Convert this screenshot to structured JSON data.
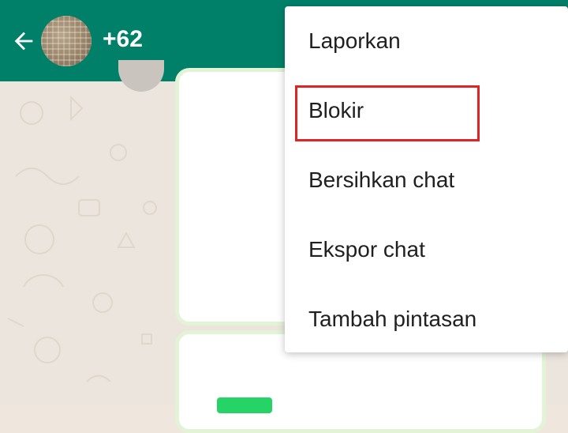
{
  "app_bar": {
    "back_icon": "arrow-left-icon",
    "contact_name": "+62",
    "color": "#008069"
  },
  "menu": {
    "items": [
      {
        "label": "Laporkan"
      },
      {
        "label": "Blokir",
        "highlighted": true
      },
      {
        "label": "Bersihkan chat"
      },
      {
        "label": "Ekspor chat"
      },
      {
        "label": "Tambah pintasan"
      }
    ]
  },
  "colors": {
    "highlight": "#e02424",
    "chat_background": "#ece5dd",
    "bubble_border": "#e2f3d6"
  }
}
